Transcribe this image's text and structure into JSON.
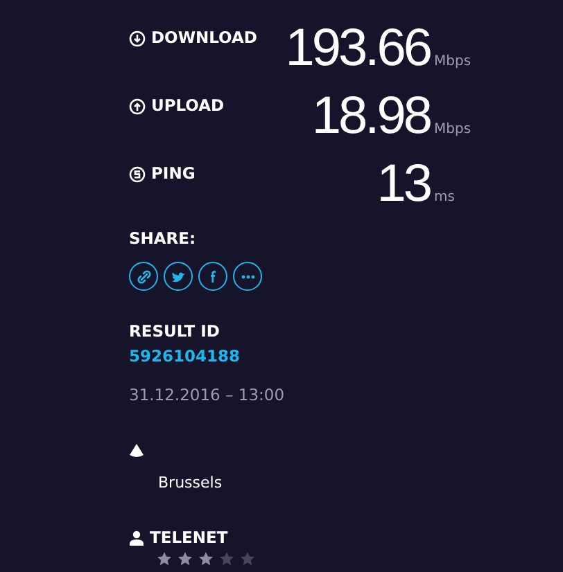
{
  "metrics": [
    {
      "kind": "download",
      "label": "DOWNLOAD",
      "value": "193.66",
      "unit": "Mbps"
    },
    {
      "kind": "upload",
      "label": "UPLOAD",
      "value": "18.98",
      "unit": "Mbps"
    },
    {
      "kind": "ping",
      "label": "PING",
      "value": "13",
      "unit": "ms"
    }
  ],
  "share": {
    "label": "SHARE:",
    "buttons": [
      {
        "kind": "link"
      },
      {
        "kind": "bird"
      },
      {
        "kind": "f"
      },
      {
        "kind": "more"
      }
    ]
  },
  "result": {
    "label": "RESULT ID",
    "id": "5926104188",
    "datetime": "31.12.2016 – 13:00"
  },
  "server": {
    "name": "Brussels"
  },
  "isp": {
    "name": "TELENET",
    "stars": 3
  }
}
